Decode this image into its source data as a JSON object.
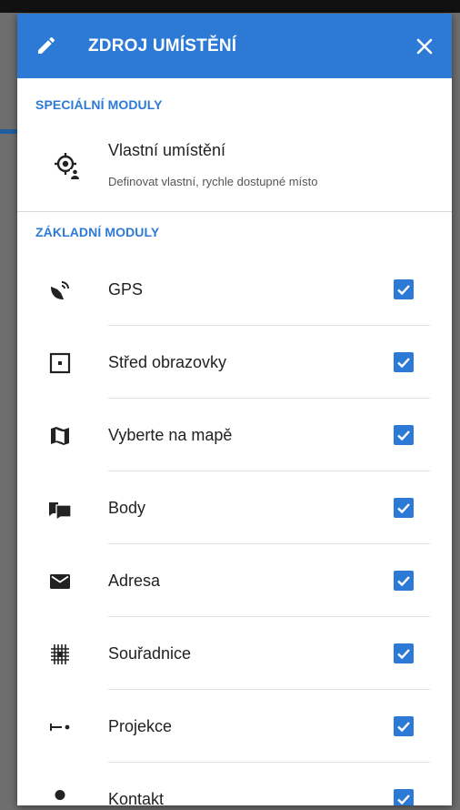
{
  "dialog": {
    "title": "ZDROJ UMÍSTĚNÍ",
    "header_color": "#2c7ad6"
  },
  "special": {
    "heading": "SPECIÁLNÍ MODULY",
    "item": {
      "name": "Vlastní umístění",
      "description": "Definovat vlastní, rychle dostupné místo",
      "icon": "custom-location-icon"
    }
  },
  "basic": {
    "heading": "ZÁKLADNÍ MODULY",
    "items": [
      {
        "label": "GPS",
        "icon": "satellite-icon",
        "checked": true
      },
      {
        "label": "Střed obrazovky",
        "icon": "screen-center-icon",
        "checked": true
      },
      {
        "label": "Vyberte na mapě",
        "icon": "map-icon",
        "checked": true
      },
      {
        "label": "Body",
        "icon": "points-icon",
        "checked": true
      },
      {
        "label": "Adresa",
        "icon": "envelope-icon",
        "checked": true
      },
      {
        "label": "Souřadnice",
        "icon": "grid-icon",
        "checked": true
      },
      {
        "label": "Projekce",
        "icon": "projection-icon",
        "checked": true
      },
      {
        "label": "Kontakt",
        "icon": "person-icon",
        "checked": true
      }
    ]
  }
}
